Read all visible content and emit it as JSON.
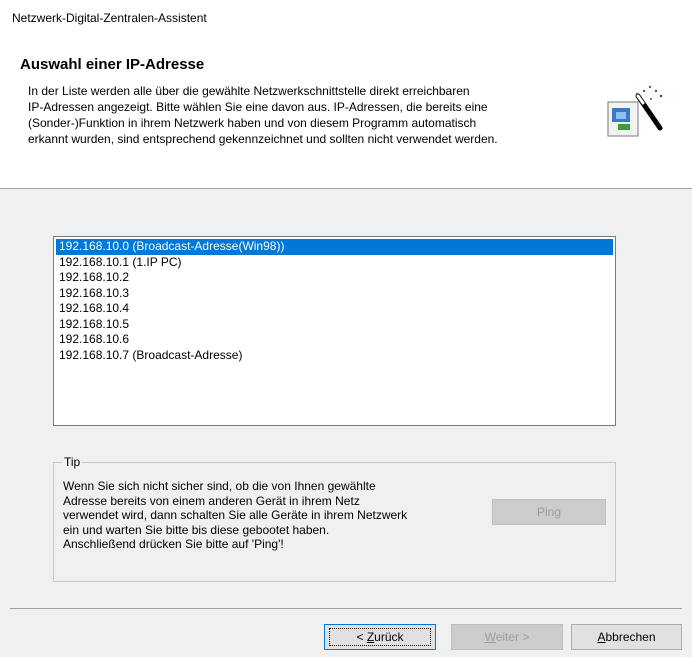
{
  "window": {
    "title": "Netzwerk-Digital-Zentralen-Assistent"
  },
  "header": {
    "heading": "Auswahl einer IP-Adresse",
    "description_lines": [
      "In der Liste werden alle über die gewählte Netzwerkschnittstelle direkt erreichbaren",
      "IP-Adressen angezeigt. Bitte wählen Sie eine davon aus. IP-Adressen, die bereits eine",
      "(Sonder-)Funktion in ihrem Netzwerk haben und von diesem Programm automatisch",
      "erkannt wurden, sind entsprechend gekennzeichnet und sollten nicht verwendet werden."
    ],
    "icon": "wizard-wand-icon"
  },
  "ip_list": {
    "selected_index": 0,
    "items": [
      "192.168.10.0 (Broadcast-Adresse(Win98))",
      "192.168.10.1 (1.IP PC)",
      "192.168.10.2",
      "192.168.10.3",
      "192.168.10.4",
      "192.168.10.5",
      "192.168.10.6",
      "192.168.10.7 (Broadcast-Adresse)"
    ]
  },
  "tip": {
    "legend": "Tip",
    "lines": [
      "Wenn Sie sich nicht sicher sind, ob die von Ihnen gewählte",
      "Adresse bereits von einem anderen Gerät in ihrem Netz",
      "verwendet wird, dann schalten Sie alle Geräte in ihrem Netzwerk",
      "ein und warten Sie bitte bis diese gebootet haben.",
      "Anschließend drücken Sie bitte auf 'Ping'!"
    ],
    "ping_label": "Ping"
  },
  "footer": {
    "back_prefix": "< ",
    "back_mnemonic": "Z",
    "back_rest": "urück",
    "next_mnemonic": "W",
    "next_rest": "eiter >",
    "cancel_mnemonic": "A",
    "cancel_rest": "bbrechen"
  }
}
